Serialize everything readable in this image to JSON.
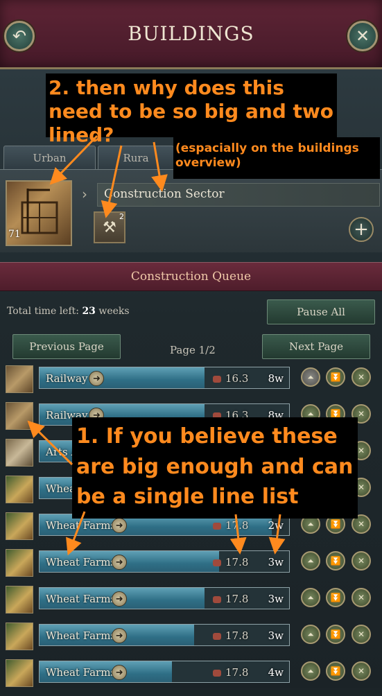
{
  "header": {
    "title": "BUILDINGS",
    "back_icon": "back-arrow-icon",
    "close_icon": "close-icon"
  },
  "tabs": [
    {
      "label": "Urban"
    },
    {
      "label": "Rura"
    }
  ],
  "sector": {
    "title": "Construction Sector",
    "level": "71",
    "sub_count": "2"
  },
  "queue": {
    "title": "Construction Queue",
    "time_left_label": "Total time left:",
    "time_left_value": "23",
    "time_left_unit": "weeks",
    "pause_all": "Pause All",
    "prev_page": "Previous Page",
    "next_page": "Next Page",
    "page": "Page 1/2",
    "rows": [
      {
        "name": "Railway",
        "cost": "16.3",
        "weeks": "8w",
        "progress": 0.66
      },
      {
        "name": "Railway",
        "cost": "16.3",
        "weeks": "8w",
        "progress": 0.66
      },
      {
        "name": "Arts A",
        "cost": "",
        "weeks": "",
        "progress": 0.5
      },
      {
        "name": "Wheat",
        "cost": "",
        "weeks": "",
        "progress": 0.5
      },
      {
        "name": "Wheat Farms",
        "cost": "17.8",
        "weeks": "2w",
        "progress": 0.93
      },
      {
        "name": "Wheat Farms",
        "cost": "17.8",
        "weeks": "3w",
        "progress": 0.72
      },
      {
        "name": "Wheat Farms",
        "cost": "17.8",
        "weeks": "3w",
        "progress": 0.66
      },
      {
        "name": "Wheat Farms",
        "cost": "17.8",
        "weeks": "3w",
        "progress": 0.62
      },
      {
        "name": "Wheat Farms",
        "cost": "17.8",
        "weeks": "4w",
        "progress": 0.53
      }
    ]
  },
  "annotations": {
    "note2": "2. then why does this need to be so big and two lined?",
    "note2_sub": "(espacially on the buildings overview)",
    "note1": "1. If you believe these are big enough and can be a single line list"
  },
  "colors": {
    "annotation": "#ff8a1e",
    "header": "#5e2435",
    "progress": "#3a8aa3"
  }
}
